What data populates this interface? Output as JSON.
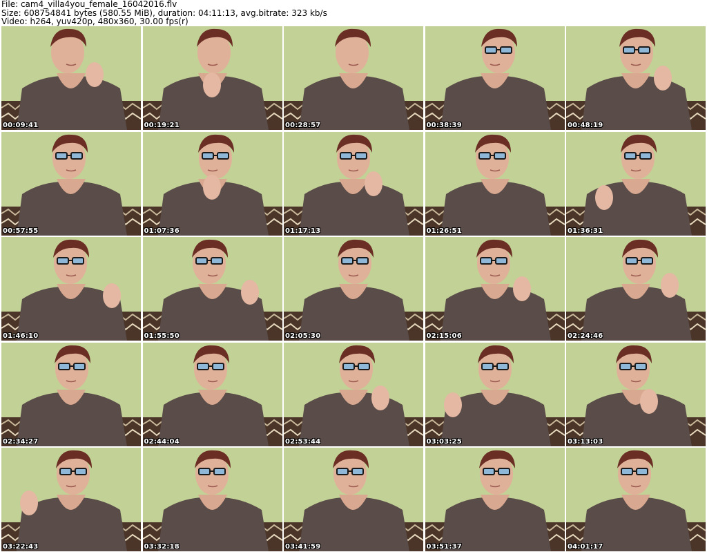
{
  "header": {
    "file_line": "File: cam4_villa4you_female_16042016.flv",
    "size_line": "Size: 608754841 bytes (580.55 MiB), duration: 04:11:13, avg.bitrate: 323 kb/s",
    "video_line": "Video: h264, yuv420p, 480x360, 30.00 fps(r)"
  },
  "thumbnails": [
    {
      "timestamp": "00:09:41"
    },
    {
      "timestamp": "00:19:21"
    },
    {
      "timestamp": "00:28:57"
    },
    {
      "timestamp": "00:38:39"
    },
    {
      "timestamp": "00:48:19"
    },
    {
      "timestamp": "00:57:55"
    },
    {
      "timestamp": "01:07:36"
    },
    {
      "timestamp": "01:17:13"
    },
    {
      "timestamp": "01:26:51"
    },
    {
      "timestamp": "01:36:31"
    },
    {
      "timestamp": "01:46:10"
    },
    {
      "timestamp": "01:55:50"
    },
    {
      "timestamp": "02:05:30"
    },
    {
      "timestamp": "02:15:06"
    },
    {
      "timestamp": "02:24:46"
    },
    {
      "timestamp": "02:34:27"
    },
    {
      "timestamp": "02:44:04"
    },
    {
      "timestamp": "02:53:44"
    },
    {
      "timestamp": "03:03:25"
    },
    {
      "timestamp": "03:13:03"
    },
    {
      "timestamp": "03:22:43"
    },
    {
      "timestamp": "03:32:18"
    },
    {
      "timestamp": "03:41:59"
    },
    {
      "timestamp": "03:51:37"
    },
    {
      "timestamp": "04:01:17"
    }
  ],
  "colors": {
    "wall": "#c2d196",
    "shirt": "#5a4c49",
    "skin": "#d9a890",
    "hair": "#6b2e24",
    "glasses": "#1a1a1a",
    "timestamp_text": "#ffffff"
  }
}
